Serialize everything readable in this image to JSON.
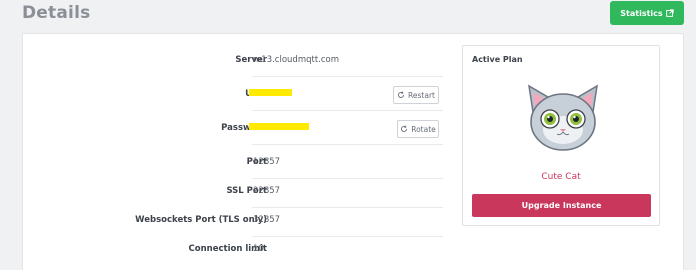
{
  "page": {
    "title": "Details"
  },
  "header": {
    "statistics_label": "Statistics"
  },
  "details": {
    "rows": [
      {
        "label": "Server",
        "value": "m13.cloudmqtt.com"
      },
      {
        "label": "User",
        "value": ""
      },
      {
        "label": "Password",
        "value": ""
      },
      {
        "label": "Port",
        "value": "12857"
      },
      {
        "label": "SSL Port",
        "value": "22857"
      },
      {
        "label": "Websockets Port (TLS only)",
        "value": "32857"
      },
      {
        "label": "Connection limit",
        "value": "10"
      }
    ],
    "restart_label": "Restart",
    "rotate_label": "Rotate",
    "redaction_color": "#ffea00"
  },
  "plan": {
    "heading": "Active Plan",
    "name": "Cute Cat",
    "upgrade_label": "Upgrade Instance",
    "accent_color": "#c9375d"
  },
  "colors": {
    "statistics_button": "#2fb85c"
  }
}
